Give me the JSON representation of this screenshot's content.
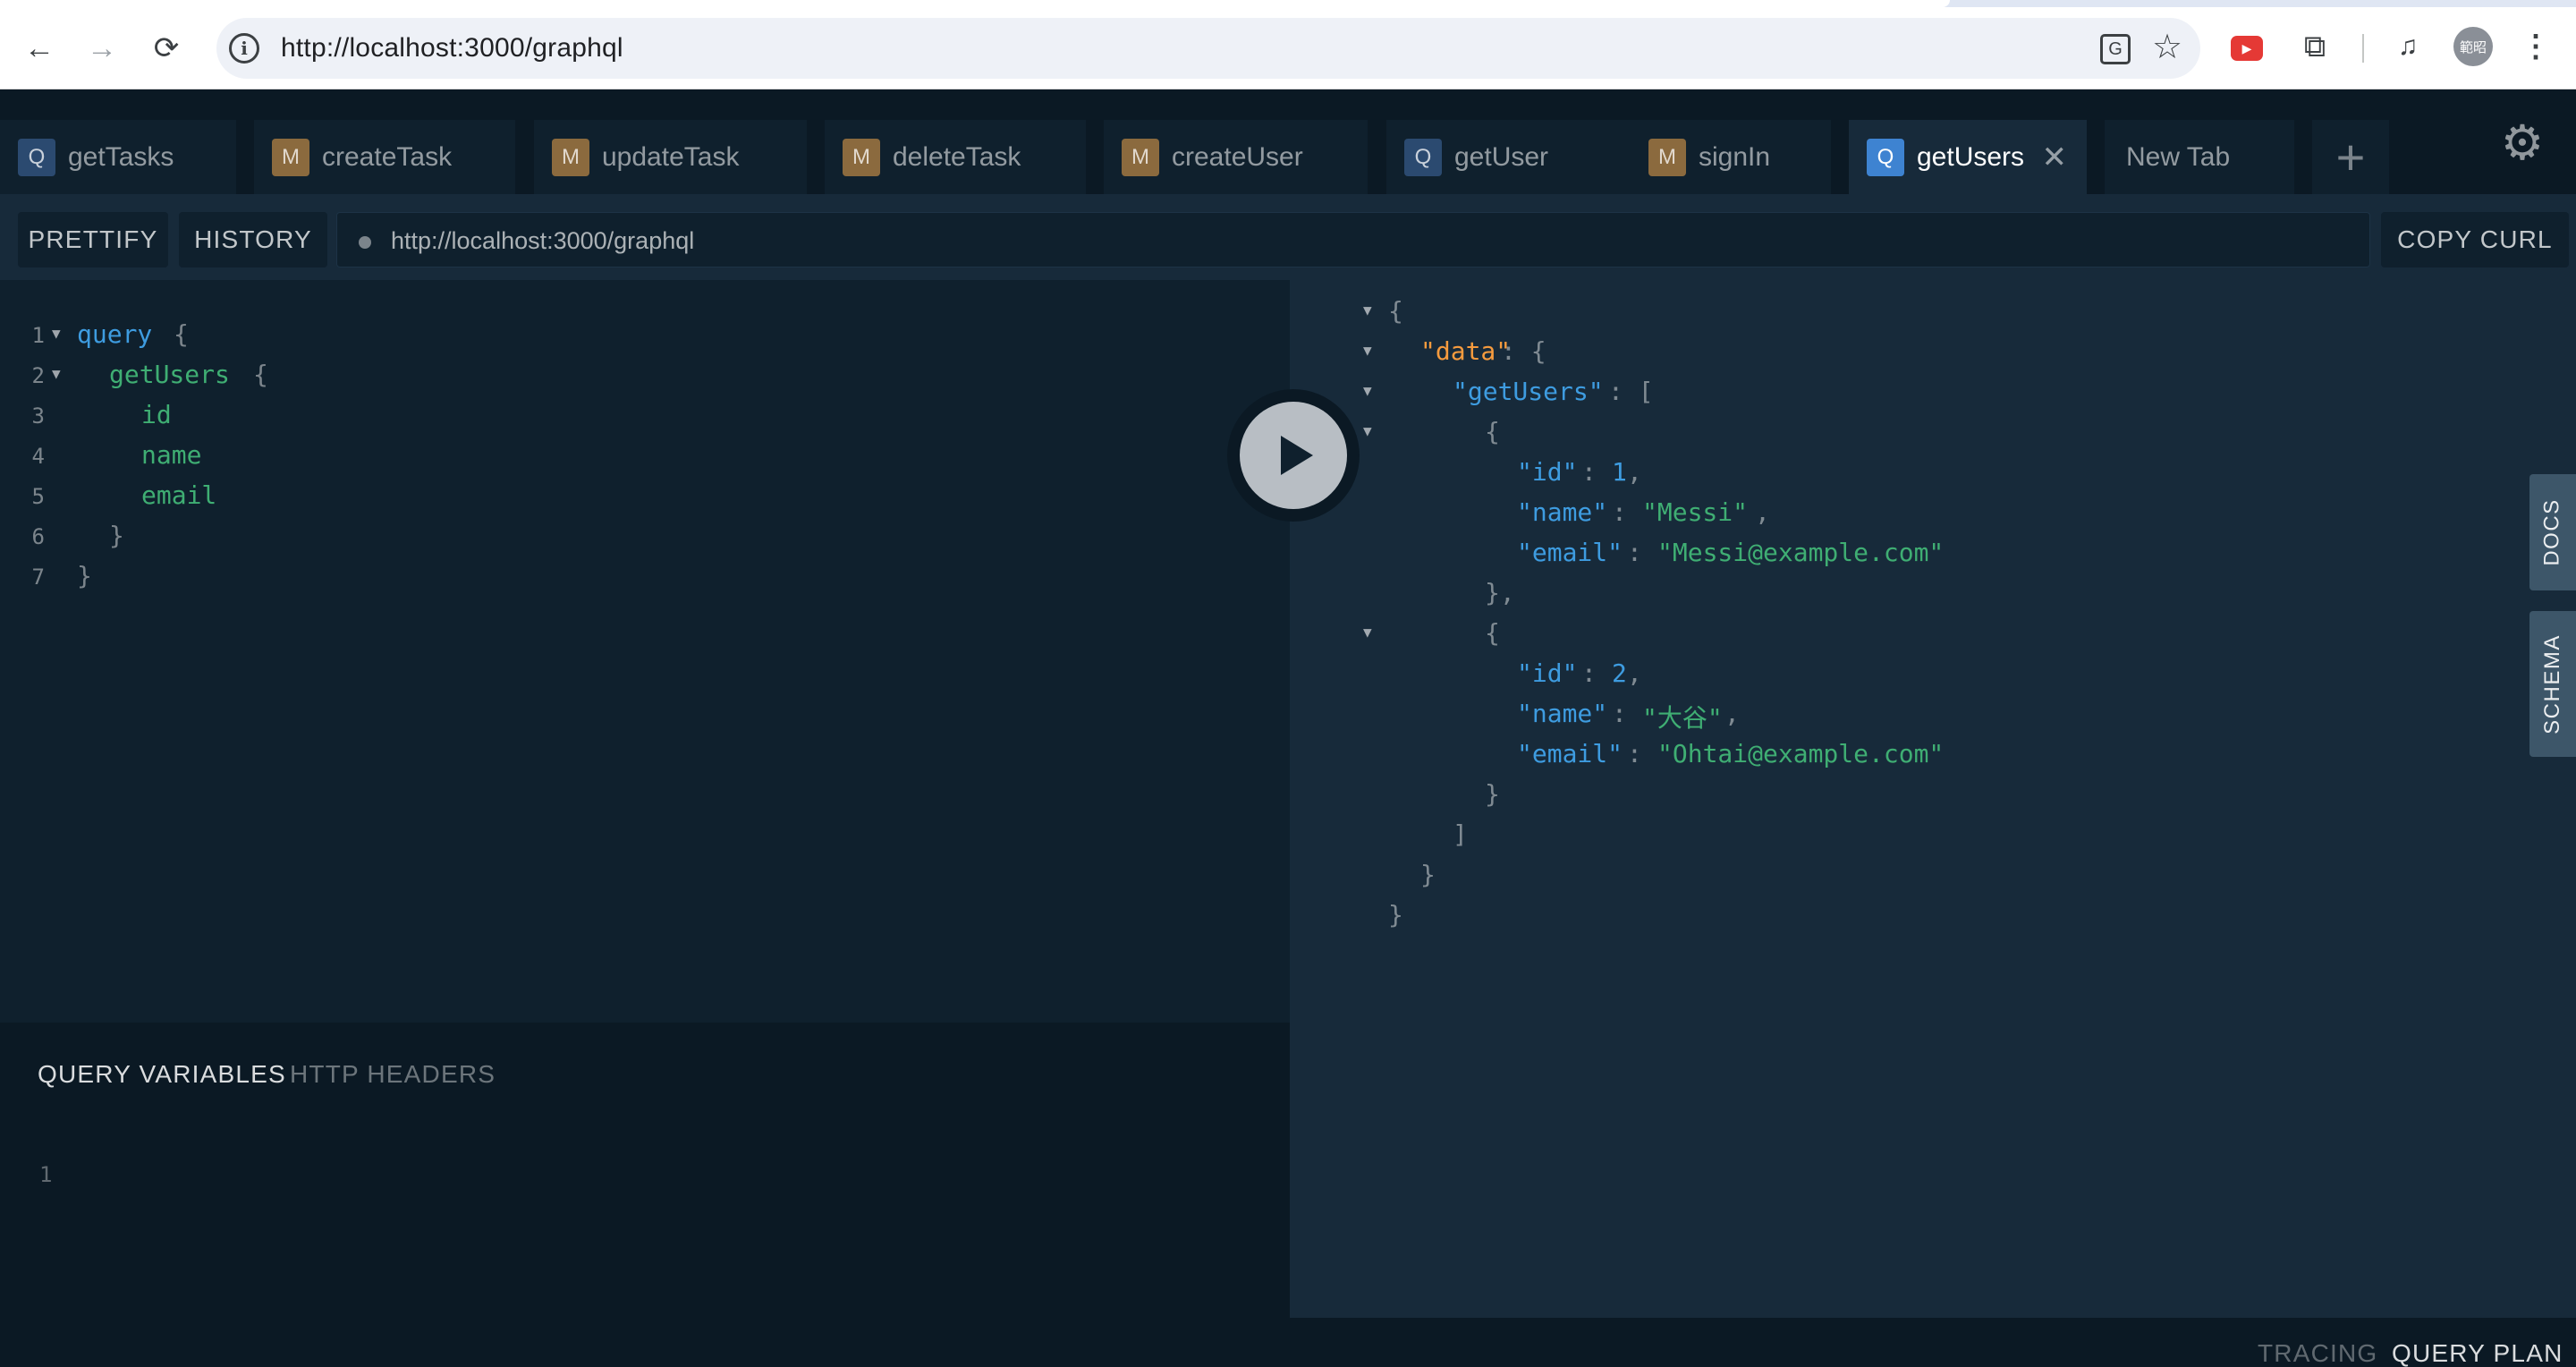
{
  "browser": {
    "url": "http://localhost:3000/graphql",
    "avatar_text": "範昭"
  },
  "tabs": [
    {
      "type": "Q",
      "label": "getTasks"
    },
    {
      "type": "M",
      "label": "createTask"
    },
    {
      "type": "M",
      "label": "updateTask"
    },
    {
      "type": "M",
      "label": "deleteTask"
    },
    {
      "type": "M",
      "label": "createUser"
    },
    {
      "type": "Q",
      "label": "getUser"
    },
    {
      "type": "M",
      "label": "signIn"
    },
    {
      "type": "Q",
      "label": "getUsers",
      "active": true
    },
    {
      "type": "",
      "label": "New Tab"
    }
  ],
  "toolbar": {
    "prettify_label": "PRETTIFY",
    "history_label": "HISTORY",
    "endpoint": "http://localhost:3000/graphql",
    "copy_curl_label": "COPY CURL"
  },
  "query_editor": {
    "line_numbers": [
      "1",
      "2",
      "3",
      "4",
      "5",
      "6",
      "7"
    ],
    "lines": [
      {
        "keyword": "query",
        "brace": "{"
      },
      {
        "field": "getUsers",
        "brace": "{"
      },
      {
        "field": "id"
      },
      {
        "field": "name"
      },
      {
        "field": "email"
      },
      {
        "brace": "}"
      },
      {
        "brace": "}"
      }
    ]
  },
  "variables_panel": {
    "query_variables_label": "QUERY VARIABLES",
    "http_headers_label": "HTTP HEADERS",
    "line_number": "1"
  },
  "result": {
    "data_key": "\"data\"",
    "getusers_key": "\"getUsers\"",
    "users": [
      {
        "id": "1",
        "name": "\"Messi\"",
        "email": "\"Messi@example.com\""
      },
      {
        "id": "2",
        "name": "\"大谷\"",
        "email": "\"Ohtai@example.com\""
      }
    ],
    "id_key": "\"id\"",
    "name_key": "\"name\"",
    "email_key": "\"email\""
  },
  "side_tabs": {
    "docs_label": "DOCS",
    "schema_label": "SCHEMA"
  },
  "bottom_bar": {
    "tracing_label": "TRACING",
    "query_plan_label": "QUERY PLAN"
  }
}
